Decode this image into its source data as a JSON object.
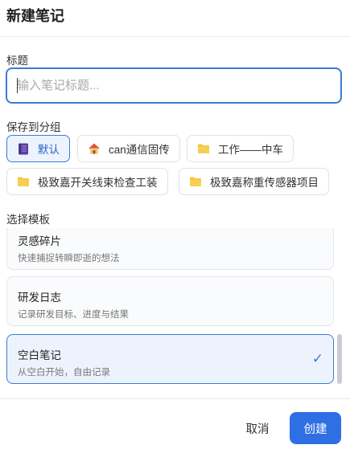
{
  "dialog": {
    "title": "新建笔记"
  },
  "title_field": {
    "label": "标题",
    "placeholder": "输入笔记标题..."
  },
  "group": {
    "label": "保存到分组",
    "options": [
      {
        "label": "默认",
        "icon": "notebook-icon",
        "selected": true
      },
      {
        "label": "can通信固传",
        "icon": "house-icon",
        "selected": false
      },
      {
        "label": "工作——中车",
        "icon": "folder-icon",
        "selected": false
      },
      {
        "label": "极致嘉开关线束检查工装",
        "icon": "folder-icon",
        "selected": false
      },
      {
        "label": "极致嘉称重传感器项目",
        "icon": "folder-icon",
        "selected": false
      }
    ]
  },
  "template": {
    "label": "选择模板",
    "items": [
      {
        "name": "灵感碎片",
        "desc": "快速捕捉转瞬即逝的想法",
        "selected": false
      },
      {
        "name": "研发日志",
        "desc": "记录研发目标、进度与结果",
        "selected": false
      },
      {
        "name": "空白笔记",
        "desc": "从空白开始，自由记录",
        "selected": true
      }
    ],
    "check_glyph": "✓"
  },
  "footer": {
    "cancel_label": "取消",
    "create_label": "创建"
  },
  "colors": {
    "accent": "#2f6fe4",
    "selected_bg": "#edf3fd",
    "folder": "#f5c542"
  }
}
